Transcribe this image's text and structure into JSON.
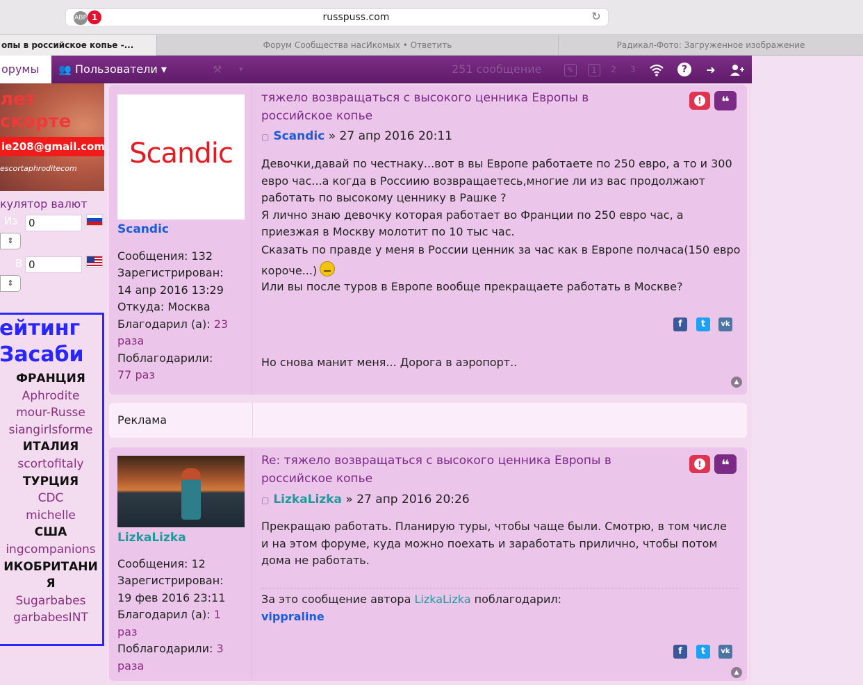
{
  "browser": {
    "url": "russpuss.com",
    "blocked_count": "1",
    "tabs": [
      "опы в российское копье -...",
      "Форум Сообщества насИкомых • Ответить",
      "Радикал-Фото: Загруженное изображение"
    ]
  },
  "nav": {
    "forums_label": "орумы",
    "users_label": "Пользователи",
    "ghost_count": "251 сообщение",
    "pages": [
      "1",
      "2",
      "3"
    ]
  },
  "sidebar": {
    "banner": {
      "line1": "лет",
      "line2": "скорте",
      "email": "ie208@gmail.com",
      "site": "escortaphroditecom"
    },
    "calculator": {
      "title": "кулятор валют",
      "from_label": "Из",
      "from_value": "0",
      "to_label": "В",
      "to_value": "0"
    },
    "rating": {
      "title_line1": "ейтинг",
      "title_line2": "Засаби",
      "items": [
        {
          "text": "ФРАНЦИЯ",
          "type": "country"
        },
        {
          "text": "Aphrodite",
          "type": "link"
        },
        {
          "text": "mour-Russe",
          "type": "link"
        },
        {
          "text": "siangirlsforme",
          "type": "link"
        },
        {
          "text": "ИТАЛИЯ",
          "type": "country"
        },
        {
          "text": "scortofitaly",
          "type": "link"
        },
        {
          "text": "ТУРЦИЯ",
          "type": "country"
        },
        {
          "text": "CDC",
          "type": "link"
        },
        {
          "text": "michelle",
          "type": "link"
        },
        {
          "text": "США",
          "type": "country"
        },
        {
          "text": "ingcompanions",
          "type": "link"
        },
        {
          "text": "ИКОБРИТАНИ",
          "type": "country"
        },
        {
          "text": "Я",
          "type": "country"
        },
        {
          "text": "Sugarbabes",
          "type": "link"
        },
        {
          "text": "garbabesINT",
          "type": "link"
        }
      ]
    }
  },
  "posts": [
    {
      "title": "тяжело возвращаться с высокого ценника Европы в российское копье",
      "author": "Scandic",
      "avatar_text": "Scandic",
      "meta_separator": "»",
      "date": "27 апр 2016 20:11",
      "stats": {
        "messages": "Сообщения: 132",
        "registered_label": "Зарегистрирован:",
        "registered_date": "14 апр 2016 13:29",
        "from": "Откуда: Москва",
        "thanked_label": "Благодарил (а):",
        "thanked_value": "23",
        "thanked_unit": "раза",
        "was_thanked_label": "Поблагодарили:",
        "was_thanked_value": "77 раз"
      },
      "body": [
        "Девочки,давай по честнаку...вот в вы Европе работаете по 250 евро, а то и 300 евро час...а когда в Россиию возвращаетесь,многие ли из вас продолжают работать по высокому ценнику в Рашке ?",
        "Я лично знаю девочку которая работает во Франции по 250 евро час, а приезжая в Москву молотит по 10 тыс час.",
        "Сказать по правде у меня в России ценник за час как в Европе полчаса(150 евро короче...)",
        "Или вы после туров в Европе вообще прекращаете работать в Москве?"
      ],
      "signature": "Но снова манит меня... Дорога в аэропорт.."
    },
    {
      "title": "Re: тяжело возвращаться с высокого ценника Европы в российское копье",
      "author": "LizkaLizka",
      "meta_separator": "»",
      "date": "27 апр 2016 20:26",
      "stats": {
        "messages": "Сообщения: 12",
        "registered_label": "Зарегистрирован:",
        "registered_date": "19 фев 2016 23:11",
        "thanked_label": "Благодарил (а):",
        "thanked_value": "1",
        "thanked_unit": "раз",
        "was_thanked_label": "Поблагодарили:",
        "was_thanked_value": "3",
        "was_thanked_unit": "раза"
      },
      "body": [
        "Прекращаю работать. Планирую туры, чтобы чаще были. Смотрю, в том числе и на этом форуме, куда можно поехать и заработать прилично, чтобы потом дома не работать."
      ],
      "thanks_prefix": "За это сообщение автора",
      "thanks_author": "LizkaLizka",
      "thanks_suffix": "поблагодарил:",
      "thanks_user": "vippraline"
    }
  ],
  "ad": {
    "label": "Реклама"
  },
  "icons": {
    "report": "!",
    "quote": "❝",
    "facebook": "f",
    "twitter": "t",
    "vk": "vk",
    "top": "▲"
  }
}
